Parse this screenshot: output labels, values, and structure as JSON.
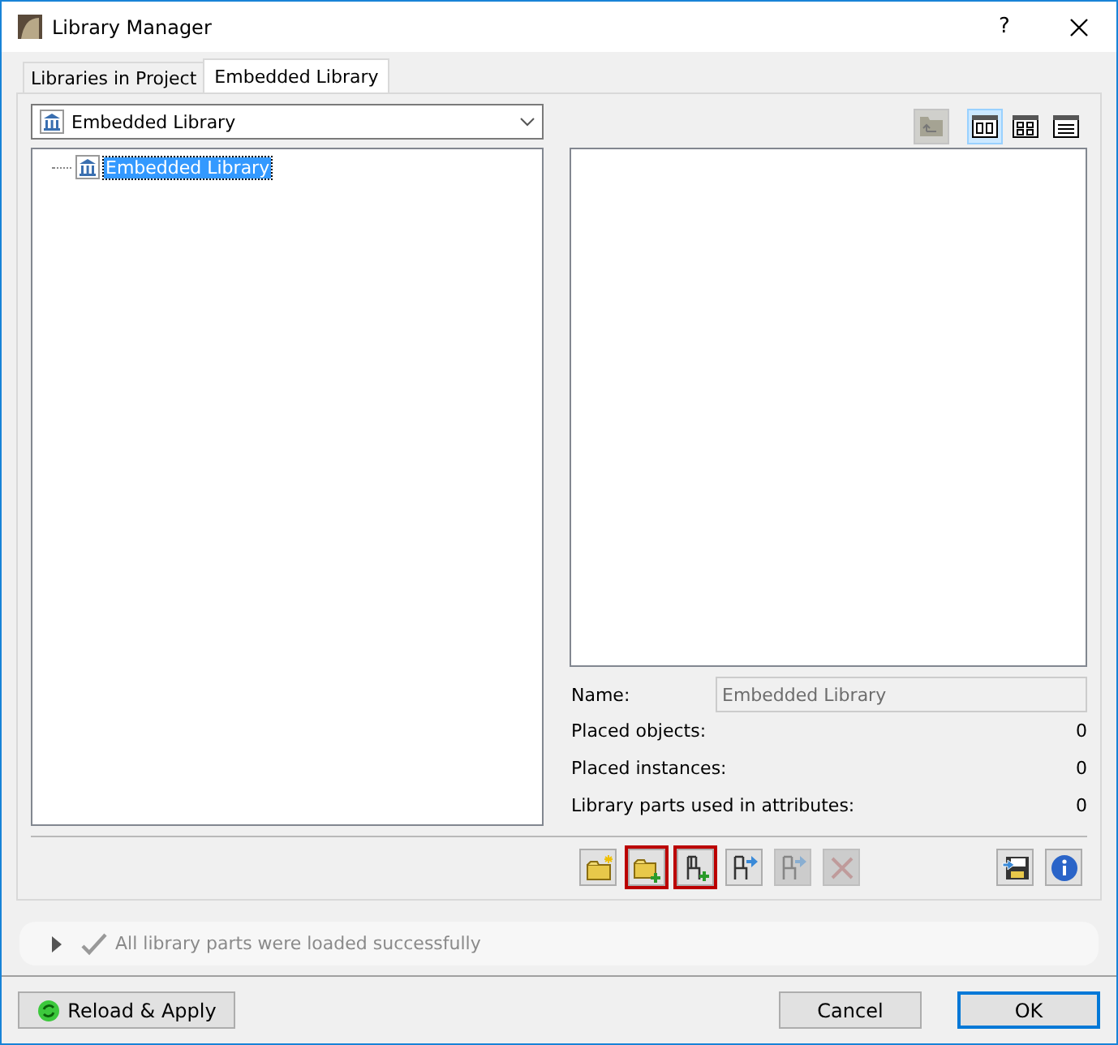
{
  "window": {
    "title": "Library Manager",
    "help": "?"
  },
  "tabs": [
    {
      "label": "Libraries in Project",
      "selected": false
    },
    {
      "label": "Embedded Library",
      "selected": true
    }
  ],
  "dropdown": {
    "value": "Embedded Library"
  },
  "tree": {
    "items": [
      {
        "label": "Embedded Library",
        "selected": true
      }
    ]
  },
  "view_buttons": [
    {
      "kind": "up-folder",
      "selected": false,
      "disabled": true
    },
    {
      "kind": "large",
      "selected": true,
      "disabled": false
    },
    {
      "kind": "grid",
      "selected": false,
      "disabled": false
    },
    {
      "kind": "list",
      "selected": false,
      "disabled": false
    }
  ],
  "details": {
    "name_label": "Name:",
    "name_value": "Embedded Library",
    "rows": [
      {
        "label": "Placed objects:",
        "value": "0"
      },
      {
        "label": "Placed instances:",
        "value": "0"
      },
      {
        "label": "Library parts used in attributes:",
        "value": "0"
      }
    ]
  },
  "toolbar": [
    {
      "kind": "new-folder",
      "highlighted": false,
      "disabled": false
    },
    {
      "kind": "add-folder",
      "highlighted": true,
      "disabled": false
    },
    {
      "kind": "add-object",
      "highlighted": true,
      "disabled": false
    },
    {
      "kind": "export-object",
      "highlighted": false,
      "disabled": false
    },
    {
      "kind": "export-object",
      "highlighted": false,
      "disabled": true
    },
    {
      "kind": "delete",
      "highlighted": false,
      "disabled": true
    },
    {
      "kind": "spacer"
    },
    {
      "kind": "save",
      "highlighted": false,
      "disabled": false
    },
    {
      "kind": "info",
      "highlighted": false,
      "disabled": false
    }
  ],
  "status": {
    "message": "All library parts were loaded successfully",
    "expanded": false
  },
  "buttons": [
    {
      "label": "Reload & Apply",
      "kind": "reload",
      "default": false
    },
    {
      "label": "Cancel",
      "kind": "plain",
      "default": false
    },
    {
      "label": "OK",
      "kind": "plain",
      "default": true
    }
  ]
}
